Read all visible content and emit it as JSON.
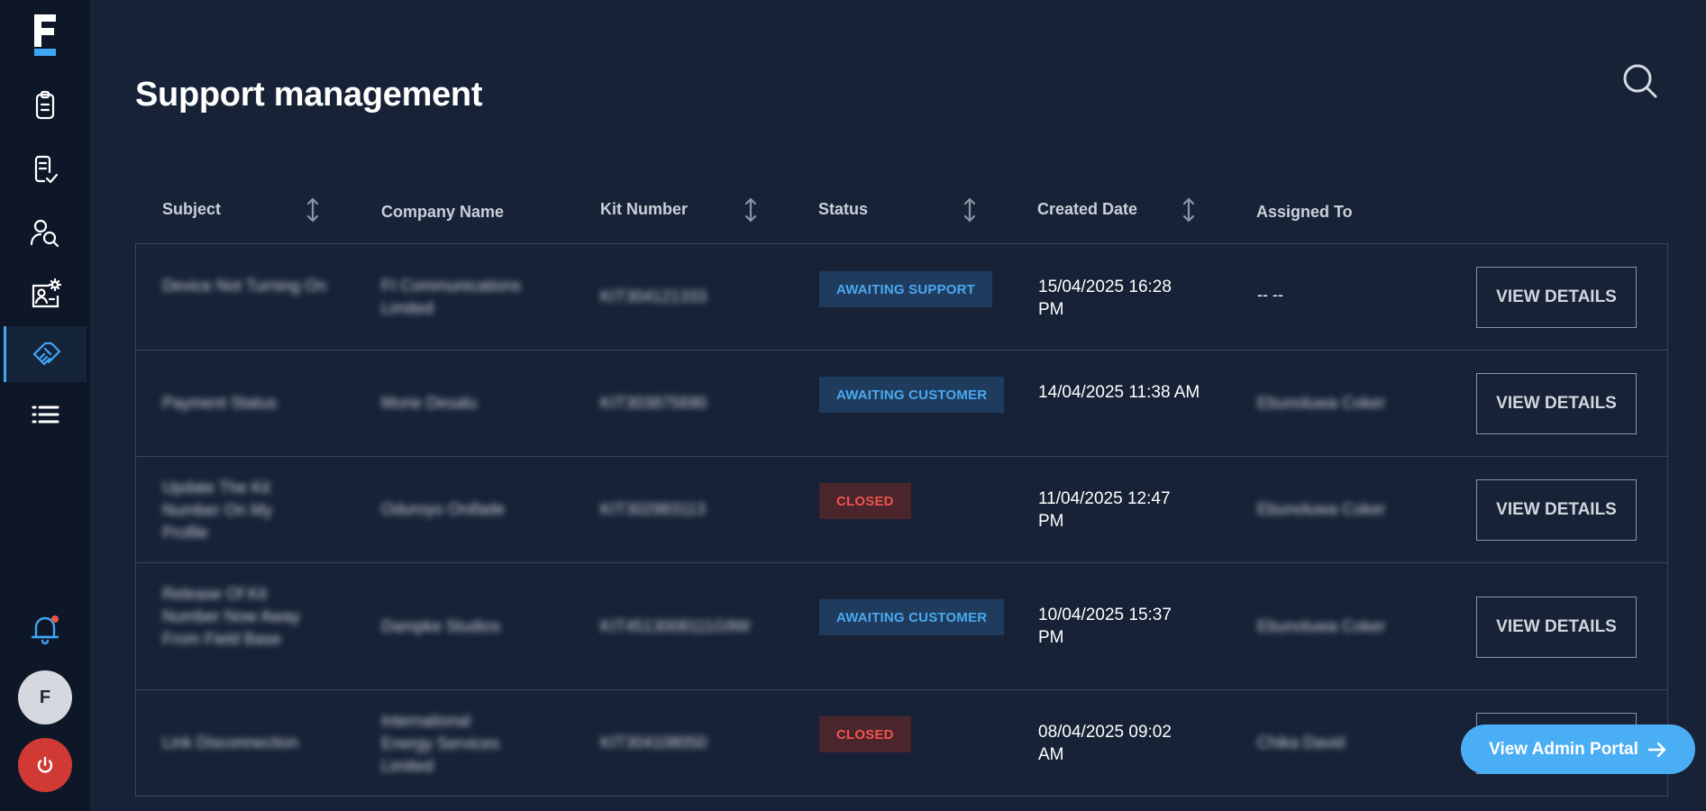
{
  "app": {
    "logo_letter": "F"
  },
  "sidebar": {
    "items": [
      {
        "name": "clipboard-icon"
      },
      {
        "name": "checklist-icon"
      },
      {
        "name": "user-search-icon"
      },
      {
        "name": "profile-settings-icon"
      },
      {
        "name": "handshake-icon",
        "active": true
      },
      {
        "name": "list-icon"
      }
    ],
    "avatar_initial": "F"
  },
  "header": {
    "title": "Support management"
  },
  "table": {
    "columns": [
      "Subject",
      "Company Name",
      "Kit Number",
      "Status",
      "Created Date",
      "Assigned To"
    ],
    "rows": [
      {
        "subject": "Device Not Turning On",
        "company": "FI Communications Limited",
        "kit": "KIT304121333",
        "status": "AWAITING SUPPORT",
        "status_color": "blue",
        "date": "15/04/2025 16:28 PM",
        "assigned": "-- --",
        "assigned_blurred": false
      },
      {
        "subject": "Payment Status",
        "company": "Morie Desalu",
        "kit": "KIT303875690",
        "status": "AWAITING CUSTOMER",
        "status_color": "blue",
        "date": "14/04/2025 11:38 AM",
        "assigned": "Ebunoluwa Coker",
        "assigned_blurred": true
      },
      {
        "subject": "Update The Kit Number On My Profile",
        "company": "Oduroyo Onifade",
        "kit": "KIT302983113",
        "status": "CLOSED",
        "status_color": "red",
        "date": "11/04/2025 12:47 PM",
        "assigned": "Ebunoluwa Coker",
        "assigned_blurred": true
      },
      {
        "subject": "Release Of Kit Number Now Away From Field Base",
        "company": "Dampke Studios",
        "kit": "KIT4513008111G9W",
        "status": "AWAITING CUSTOMER",
        "status_color": "blue",
        "date": "10/04/2025 15:37 PM",
        "assigned": "Ebunoluwa Coker",
        "assigned_blurred": true
      },
      {
        "subject": "Link Disconnection",
        "company": "International Energy Services Limited",
        "kit": "KIT304108050",
        "status": "CLOSED",
        "status_color": "red",
        "date": "08/04/2025 09:02 AM",
        "assigned": "Chika David",
        "assigned_blurred": true
      }
    ],
    "action_label": "VIEW DETAILS"
  },
  "admin_portal_button": {
    "label": "View Admin Portal"
  },
  "colors": {
    "accent": "#4aaef5",
    "bg": "#172236",
    "sidebar": "#0e1727",
    "danger": "#d13a34"
  }
}
